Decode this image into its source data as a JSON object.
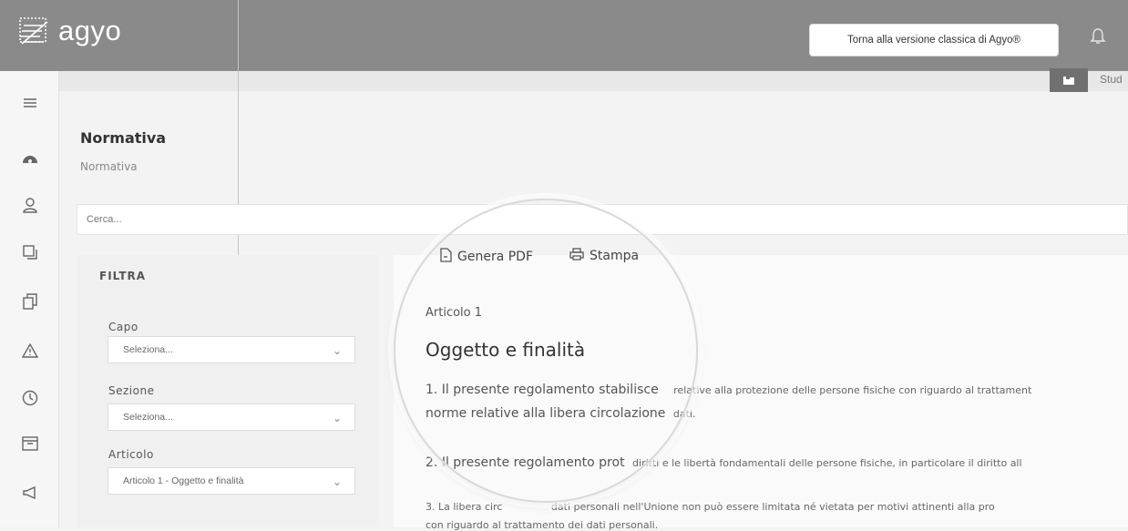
{
  "header": {
    "logo_text": "agyo",
    "classic_button_label": "Torna alla versione classica di Agyo®",
    "studio_label": "Stud"
  },
  "sidebar": {
    "icons": [
      "menu-icon",
      "dashboard-icon",
      "user-icon",
      "documents-icon",
      "copy-icon",
      "warning-icon",
      "clock-icon",
      "archive-icon",
      "megaphone-icon"
    ]
  },
  "page": {
    "title": "Normativa",
    "breadcrumb": "Normativa",
    "search_placeholder": "Cerca..."
  },
  "filter": {
    "title": "FILTRA",
    "fields": [
      {
        "label": "Capo",
        "value": "Seleziona..."
      },
      {
        "label": "Sezione",
        "value": "Seleziona..."
      },
      {
        "label": "Articolo",
        "value": "Articolo 1 - Oggetto e finalità"
      }
    ]
  },
  "toolbar": {
    "pdf_label": "Genera PDF",
    "print_label": "Stampa"
  },
  "article": {
    "label": "Articolo 1",
    "title": "Oggetto e finalità",
    "p1_a": "1. Il presente regolamento stabilisce",
    "p1_b": "relative alla protezione delle persone fisiche con riguardo al trattament",
    "p1_c": "norme relative alla libera circolazione",
    "p1_d": "dati.",
    "p2_a": "2.",
    "p2_b": "Il presente regolamento prot",
    "p2_c": "diritti e le libertà fondamentali delle persone fisiche, in particolare il diritto all",
    "p3_a": "3. La libera circ",
    "p3_b": "dati personali nell'Unione non può essere limitata né vietata per motivi attinenti alla pro",
    "p3_c": "con riguardo al trattamento dei dati personali."
  }
}
